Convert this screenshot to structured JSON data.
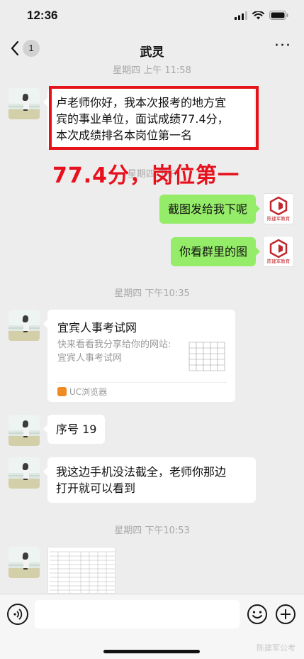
{
  "status_bar": {
    "time": "12:36"
  },
  "nav": {
    "back_count": "1",
    "title": "武灵",
    "more": "···"
  },
  "messages": {
    "ts1": "星期四 上午 11:58",
    "m1_lines": [
      "卢老师你好，我本次报考的地方宜",
      "宾的事业单位，面试成绩77.4分，",
      "本次成绩排名本岗位第一名"
    ],
    "overlay": "77.4分，岗位第一",
    "m2": "截图发给我下呢",
    "m3": "你看群里的图",
    "ts2": "星期四 下午10:35",
    "card": {
      "title": "宜宾人事考试网",
      "desc": "快来看看我分享给你的网站:宜宾人事考试网",
      "source": "UC浏览器"
    },
    "m4": "序号 19",
    "m5_lines": [
      "我这边手机没法截全，老师你那边",
      "打开就可以看到"
    ],
    "ts3": "星期四 下午10:53"
  },
  "brand_logo_text": "陈建军教育",
  "watermark": "陈建军公考",
  "colors": {
    "bg": "#ededed",
    "bubble_green": "#95ec69",
    "highlight_red": "#e5121a"
  }
}
